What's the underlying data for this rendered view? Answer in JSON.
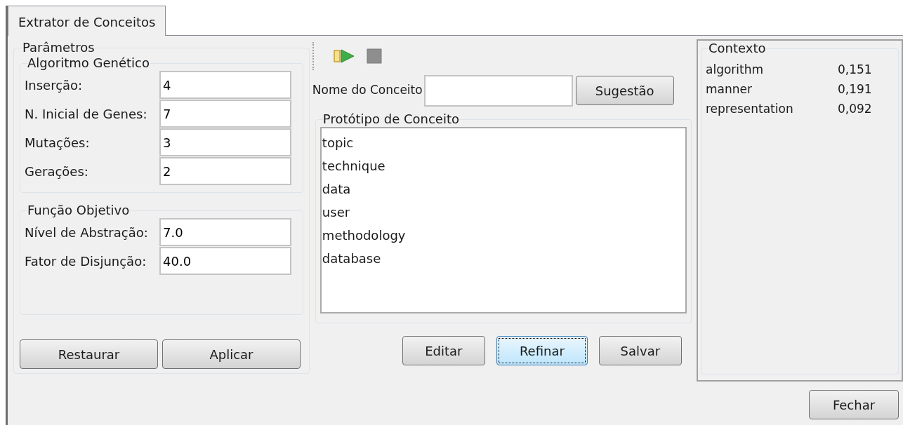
{
  "tabs": [
    {
      "label": "Extrator de Conceitos",
      "selected": true
    }
  ],
  "parameters": {
    "title": "Parâmetros",
    "groups": [
      {
        "title": "Algoritmo Genético",
        "fields": [
          {
            "label": "Inserção:",
            "value": "4"
          },
          {
            "label": "N. Inicial de Genes:",
            "value": "7"
          },
          {
            "label": "Mutações:",
            "value": "3"
          },
          {
            "label": "Gerações:",
            "value": "2"
          }
        ]
      },
      {
        "title": "Função Objetivo",
        "fields": [
          {
            "label": "Nível de Abstração:",
            "value": "7.0"
          },
          {
            "label": "Fator de Disjunção:",
            "value": "40.0"
          }
        ]
      }
    ],
    "buttons": [
      {
        "label": "Restaurar",
        "focused": false
      },
      {
        "label": "Aplicar",
        "focused": false
      }
    ]
  },
  "concept": {
    "name_label": "Nome do Conceito",
    "suggest_button": "Sugestão",
    "prototype": {
      "title": "Protótipo de Conceito",
      "items": [
        "topic",
        "technique",
        "data",
        "user",
        "methodology",
        "database"
      ]
    },
    "buttons": [
      {
        "label": "Editar",
        "focused": false
      },
      {
        "label": "Refinar",
        "focused": true
      },
      {
        "label": "Salvar",
        "focused": false
      }
    ]
  },
  "context": {
    "title": "Contexto",
    "rows": [
      {
        "term": "algorithm",
        "weight": "0,151"
      },
      {
        "term": "manner",
        "weight": "0,191"
      },
      {
        "term": "representation",
        "weight": "0,092"
      }
    ]
  },
  "close_button": "Fechar"
}
